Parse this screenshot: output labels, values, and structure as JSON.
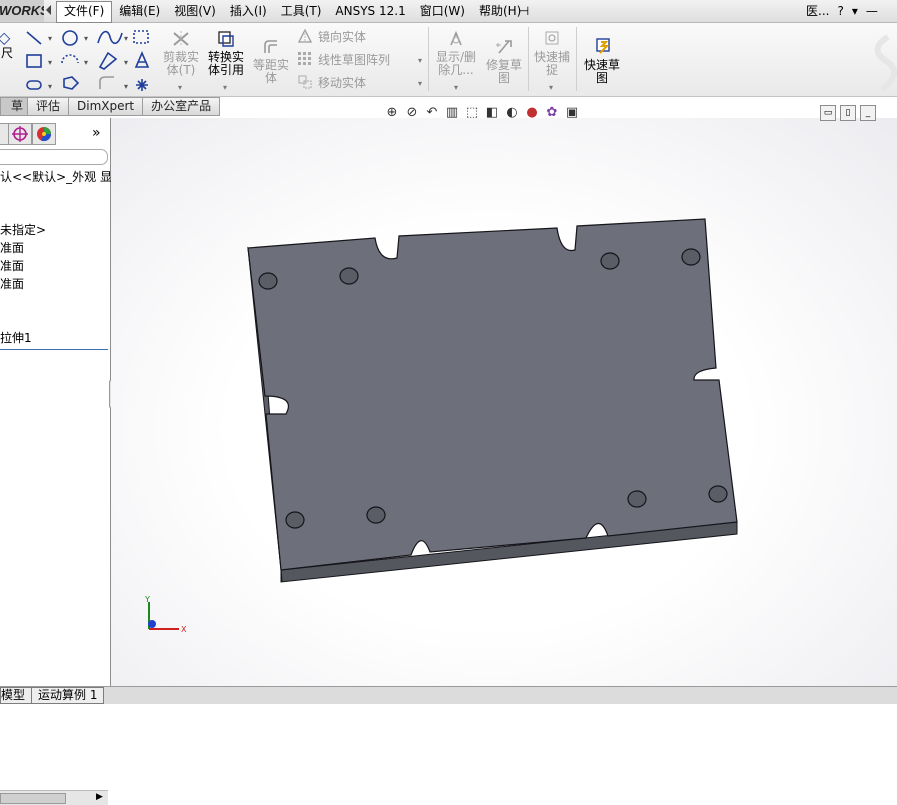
{
  "app": {
    "brand": "WORKS"
  },
  "menu": [
    {
      "label": "文件(F)"
    },
    {
      "label": "编辑(E)"
    },
    {
      "label": "视图(V)"
    },
    {
      "label": "插入(I)"
    },
    {
      "label": "工具(T)"
    },
    {
      "label": "ANSYS 12.1"
    },
    {
      "label": "窗口(W)"
    },
    {
      "label": "帮助(H)"
    }
  ],
  "menu_right": {
    "search": "医...",
    "help": "?",
    "dropdown": "▾",
    "minimize": "—"
  },
  "ribbon": {
    "smart_dim": "尺",
    "trim": "剪裁实体(T)",
    "convert": "转换实体引用",
    "offset": "等距实体",
    "mirror": "镜向实体",
    "linear_pattern": "线性草图阵列",
    "move": "移动实体",
    "show_delete": "显示/删除几...",
    "repair": "修复草图",
    "quick_snap": "快速捕捉",
    "rapid_sketch": "快速草图"
  },
  "tabs": [
    {
      "label": "草图"
    },
    {
      "label": "评估"
    },
    {
      "label": "DimXpert"
    },
    {
      "label": "办公室产品"
    }
  ],
  "feature_tree": {
    "config_line": "认<<默认>_外观 显示",
    "material": "未指定>",
    "plane1": "准面",
    "plane2": "准面",
    "plane3": "准面",
    "feature": "拉伸1",
    "more": "»"
  },
  "bottom_tabs": [
    {
      "label": "模型"
    },
    {
      "label": "运动算例 1"
    }
  ],
  "triad": {
    "x": "X",
    "y": "Y"
  },
  "colors": {
    "part_face": "#6d6f7b",
    "part_side": "#55575f",
    "edge": "#15151a"
  }
}
